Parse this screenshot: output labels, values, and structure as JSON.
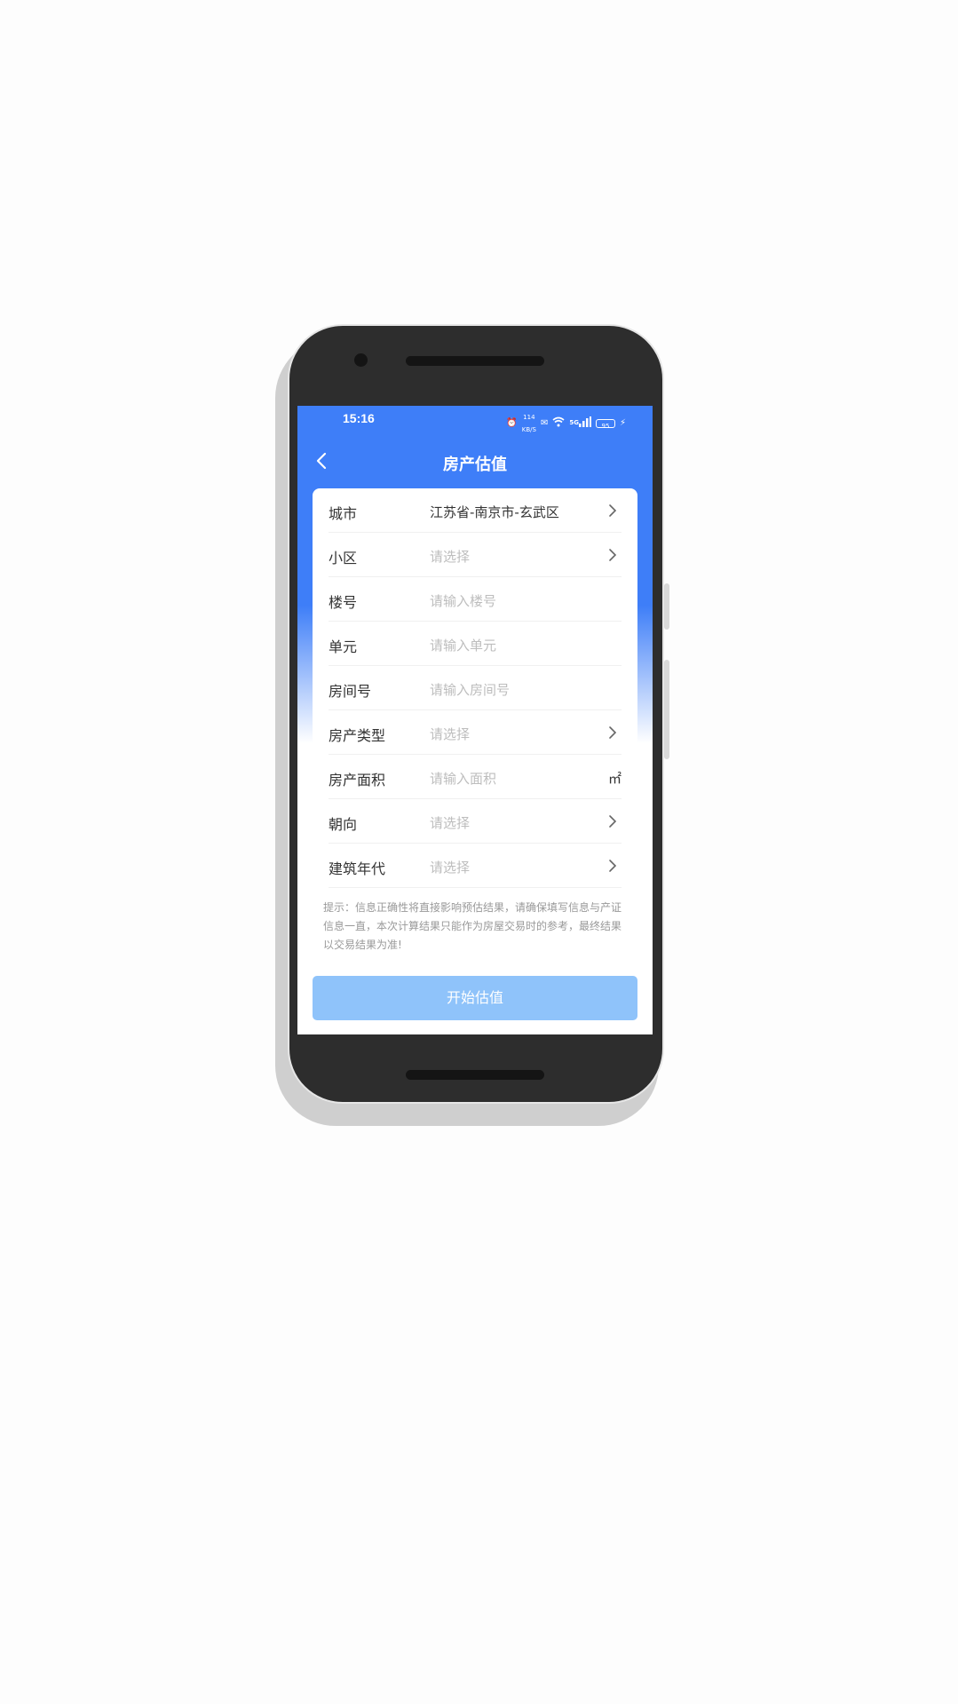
{
  "statusbar": {
    "time": "15:16",
    "net_speed_top": "114",
    "net_speed_bottom": "KB/S",
    "network": "5G",
    "battery": "95"
  },
  "header": {
    "title": "房产估值"
  },
  "form": {
    "rows": [
      {
        "label": "城市",
        "value": "江苏省-南京市-玄武区",
        "placeholder": false,
        "trailing": "chevron"
      },
      {
        "label": "小区",
        "value": "请选择",
        "placeholder": true,
        "trailing": "chevron"
      },
      {
        "label": "楼号",
        "value": "请输入楼号",
        "placeholder": true,
        "trailing": "none"
      },
      {
        "label": "单元",
        "value": "请输入单元",
        "placeholder": true,
        "trailing": "none"
      },
      {
        "label": "房间号",
        "value": "请输入房间号",
        "placeholder": true,
        "trailing": "none"
      },
      {
        "label": "房产类型",
        "value": "请选择",
        "placeholder": true,
        "trailing": "chevron"
      },
      {
        "label": "房产面积",
        "value": "请输入面积",
        "placeholder": true,
        "trailing": "unit",
        "unit": "㎡"
      },
      {
        "label": "朝向",
        "value": "请选择",
        "placeholder": true,
        "trailing": "chevron"
      },
      {
        "label": "建筑年代",
        "value": "请选择",
        "placeholder": true,
        "trailing": "chevron"
      }
    ],
    "tip": "提示：信息正确性将直接影响预估结果，请确保填写信息与产证信息一直，本次计算结果只能作为房屋交易时的参考，最终结果以交易结果为准!"
  },
  "actions": {
    "start_label": "开始估值"
  },
  "colors": {
    "primary": "#3e7ef8",
    "button": "#8fc3fa",
    "placeholder": "#bdbdbd",
    "text": "#333333"
  }
}
